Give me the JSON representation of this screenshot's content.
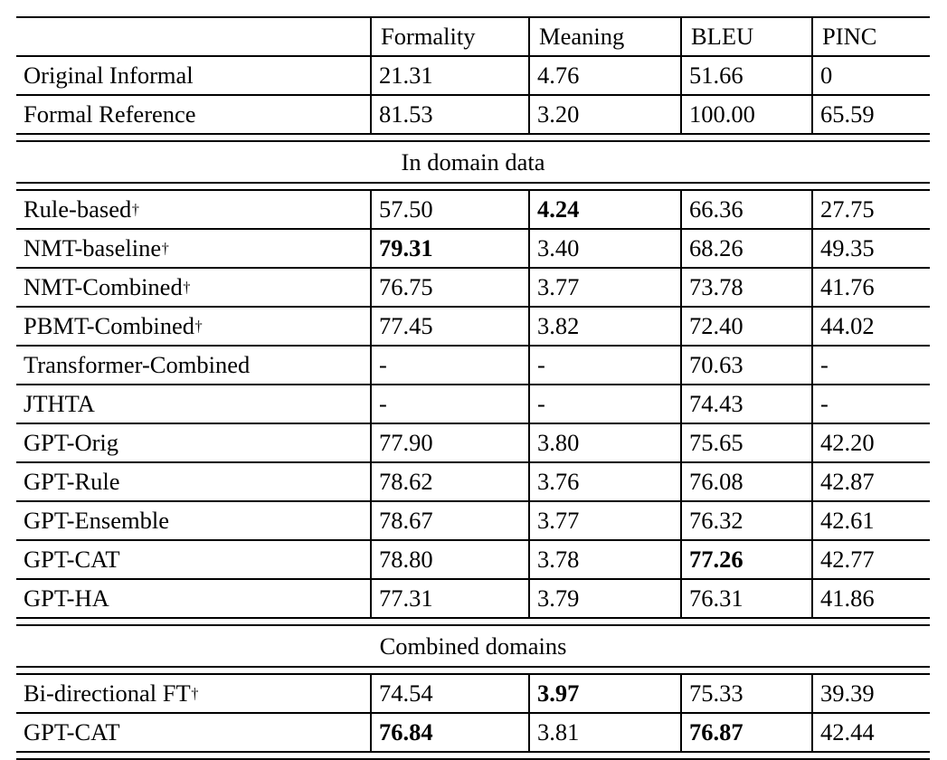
{
  "table": {
    "columns": [
      "",
      "Formality",
      "Meaning",
      "BLEU",
      "PINC"
    ],
    "header": {
      "label_blank": "",
      "formality": "Formality",
      "meaning": "Meaning",
      "bleu": "BLEU",
      "pinc": "PINC"
    },
    "dagger": "†",
    "sections": [
      {
        "title": null,
        "rows": [
          {
            "name": "Original Informal",
            "dagger": false,
            "formality": "21.31",
            "formality_bold": false,
            "meaning": "4.76",
            "meaning_bold": false,
            "bleu": "51.66",
            "bleu_bold": false,
            "pinc": "0",
            "pinc_bold": false
          },
          {
            "name": "Formal Reference",
            "dagger": false,
            "formality": "81.53",
            "formality_bold": false,
            "meaning": "3.20",
            "meaning_bold": false,
            "bleu": "100.00",
            "bleu_bold": false,
            "pinc": "65.59",
            "pinc_bold": false
          }
        ]
      },
      {
        "title": "In domain data",
        "rows": [
          {
            "name": "Rule-based",
            "dagger": true,
            "formality": "57.50",
            "formality_bold": false,
            "meaning": "4.24",
            "meaning_bold": true,
            "bleu": "66.36",
            "bleu_bold": false,
            "pinc": "27.75",
            "pinc_bold": false
          },
          {
            "name": "NMT-baseline",
            "dagger": true,
            "formality": "79.31",
            "formality_bold": true,
            "meaning": "3.40",
            "meaning_bold": false,
            "bleu": "68.26",
            "bleu_bold": false,
            "pinc": "49.35",
            "pinc_bold": false
          },
          {
            "name": "NMT-Combined",
            "dagger": true,
            "formality": "76.75",
            "formality_bold": false,
            "meaning": "3.77",
            "meaning_bold": false,
            "bleu": "73.78",
            "bleu_bold": false,
            "pinc": "41.76",
            "pinc_bold": false
          },
          {
            "name": "PBMT-Combined",
            "dagger": true,
            "formality": "77.45",
            "formality_bold": false,
            "meaning": "3.82",
            "meaning_bold": false,
            "bleu": "72.40",
            "bleu_bold": false,
            "pinc": "44.02",
            "pinc_bold": false
          },
          {
            "name": "Transformer-Combined",
            "dagger": false,
            "formality": "-",
            "formality_bold": false,
            "meaning": "-",
            "meaning_bold": false,
            "bleu": "70.63",
            "bleu_bold": false,
            "pinc": "-",
            "pinc_bold": false
          },
          {
            "name": "JTHTA",
            "dagger": false,
            "formality": "-",
            "formality_bold": false,
            "meaning": "-",
            "meaning_bold": false,
            "bleu": "74.43",
            "bleu_bold": false,
            "pinc": "-",
            "pinc_bold": false
          },
          {
            "name": "GPT-Orig",
            "dagger": false,
            "formality": "77.90",
            "formality_bold": false,
            "meaning": "3.80",
            "meaning_bold": false,
            "bleu": "75.65",
            "bleu_bold": false,
            "pinc": "42.20",
            "pinc_bold": false
          },
          {
            "name": "GPT-Rule",
            "dagger": false,
            "formality": "78.62",
            "formality_bold": false,
            "meaning": "3.76",
            "meaning_bold": false,
            "bleu": "76.08",
            "bleu_bold": false,
            "pinc": "42.87",
            "pinc_bold": false
          },
          {
            "name": "GPT-Ensemble",
            "dagger": false,
            "formality": "78.67",
            "formality_bold": false,
            "meaning": "3.77",
            "meaning_bold": false,
            "bleu": "76.32",
            "bleu_bold": false,
            "pinc": "42.61",
            "pinc_bold": false
          },
          {
            "name": "GPT-CAT",
            "dagger": false,
            "formality": "78.80",
            "formality_bold": false,
            "meaning": "3.78",
            "meaning_bold": false,
            "bleu": "77.26",
            "bleu_bold": true,
            "pinc": "42.77",
            "pinc_bold": false
          },
          {
            "name": "GPT-HA",
            "dagger": false,
            "formality": "77.31",
            "formality_bold": false,
            "meaning": "3.79",
            "meaning_bold": false,
            "bleu": "76.31",
            "bleu_bold": false,
            "pinc": "41.86",
            "pinc_bold": false
          }
        ]
      },
      {
        "title": "Combined domains",
        "rows": [
          {
            "name": "Bi-directional FT",
            "dagger": true,
            "formality": "74.54",
            "formality_bold": false,
            "meaning": "3.97",
            "meaning_bold": true,
            "bleu": "75.33",
            "bleu_bold": false,
            "pinc": "39.39",
            "pinc_bold": false
          },
          {
            "name": "GPT-CAT",
            "dagger": false,
            "formality": "76.84",
            "formality_bold": true,
            "meaning": "3.81",
            "meaning_bold": false,
            "bleu": "76.87",
            "bleu_bold": true,
            "pinc": "42.44",
            "pinc_bold": false
          }
        ]
      }
    ],
    "section_titles": {
      "in_domain": "In domain data",
      "combined": "Combined domains"
    }
  }
}
